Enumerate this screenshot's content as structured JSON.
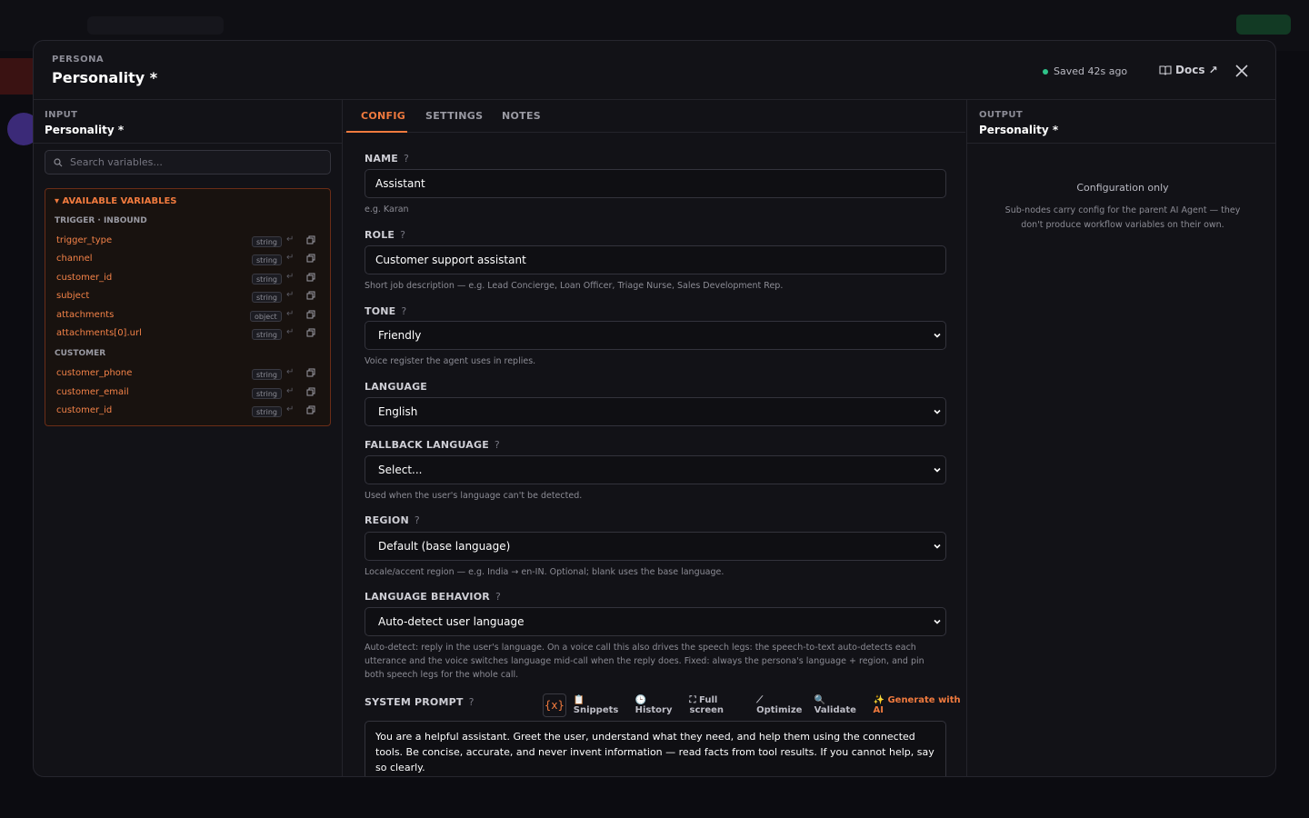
{
  "modal": {
    "kicker": "PERSONA",
    "title": "Personality *",
    "saved_status": "Saved 42s ago",
    "docs_label": "Docs ↗"
  },
  "input_panel": {
    "label": "INPUT",
    "title": "Personality *",
    "search_placeholder": "Search variables...",
    "variables_header": "▾ AVAILABLE VARIABLES",
    "groups": [
      {
        "name": "TRIGGER · INBOUND",
        "items": [
          {
            "name": "trigger_type",
            "type": "string"
          },
          {
            "name": "channel",
            "type": "string"
          },
          {
            "name": "customer_id",
            "type": "string"
          },
          {
            "name": "subject",
            "type": "string"
          },
          {
            "name": "attachments",
            "type": "object"
          },
          {
            "name": "attachments[0].url",
            "type": "string"
          }
        ]
      },
      {
        "name": "CUSTOMER",
        "items": [
          {
            "name": "customer_phone",
            "type": "string"
          },
          {
            "name": "customer_email",
            "type": "string"
          },
          {
            "name": "customer_id",
            "type": "string"
          }
        ]
      }
    ]
  },
  "tabs": [
    {
      "label": "CONFIG"
    },
    {
      "label": "SETTINGS"
    },
    {
      "label": "NOTES"
    }
  ],
  "form": {
    "name": {
      "label": "NAME",
      "value": "Assistant",
      "hint": "e.g. Karan"
    },
    "role": {
      "label": "ROLE",
      "value": "Customer support assistant",
      "hint": "Short job description — e.g. Lead Concierge, Loan Officer, Triage Nurse, Sales Development Rep."
    },
    "tone": {
      "label": "TONE",
      "value": "Friendly",
      "hint": "Voice register the agent uses in replies."
    },
    "language": {
      "label": "LANGUAGE",
      "value": "English"
    },
    "fallback_language": {
      "label": "FALLBACK LANGUAGE",
      "value": "Select...",
      "hint": "Used when the user's language can't be detected."
    },
    "region": {
      "label": "REGION",
      "value": "Default (base language)",
      "hint": "Locale/accent region — e.g. India → en-IN. Optional; blank uses the base language."
    },
    "language_behavior": {
      "label": "LANGUAGE BEHAVIOR",
      "value": "Auto-detect user language",
      "hint": "Auto-detect: reply in the user's language. On a voice call this also drives the speech legs: the speech-to-text auto-detects each utterance and the voice switches language mid-call when the reply does. Fixed: always the persona's language + region, and pin both speech legs for the whole call."
    },
    "system_prompt": {
      "label": "SYSTEM PROMPT",
      "value": "You are a helpful assistant. Greet the user, understand what they need, and help them using the connected tools. Be concise, accurate, and never invent information — read facts from tool results. If you cannot help, say so clearly."
    },
    "help_mark": "?"
  },
  "toolbar": {
    "variables_label": "{x}",
    "snippets": "📋 Snippets",
    "history": "🕒 History",
    "full_screen": "⛶ Full screen",
    "optimize": "⟋ Optimize",
    "validate": "🔍 Validate",
    "generate": "✨ Generate with AI"
  },
  "output_panel": {
    "label": "OUTPUT",
    "title": "Personality *",
    "config_title": "Configuration only",
    "config_desc": "Sub-nodes carry config for the parent AI Agent — they don't produce workflow variables on their own."
  },
  "colors": {
    "accent": "#f07a3e",
    "saved_dot": "#2fc48a"
  }
}
